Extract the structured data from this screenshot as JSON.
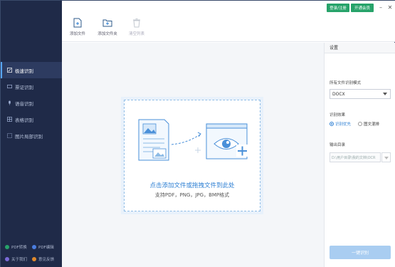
{
  "sidebar": {
    "items": [
      {
        "label": "极速识别",
        "icon": "edit-icon",
        "active": true
      },
      {
        "label": "票证识别",
        "icon": "card-icon",
        "active": false
      },
      {
        "label": "语音识别",
        "icon": "microphone-icon",
        "active": false
      },
      {
        "label": "表格识别",
        "icon": "table-icon",
        "active": false
      },
      {
        "label": "图片局部识别",
        "icon": "crop-icon",
        "active": false
      }
    ],
    "footer": [
      {
        "label": "PDF转换",
        "icon": "pdf-convert-icon",
        "color": "#27a36a"
      },
      {
        "label": "PDF编辑",
        "icon": "pdf-edit-icon",
        "color": "#4a7de0"
      },
      {
        "label": "关于我们",
        "icon": "info-icon",
        "color": "#7a6ad8"
      },
      {
        "label": "意见反馈",
        "icon": "feedback-icon",
        "color": "#e08a2b"
      }
    ]
  },
  "toolbar": {
    "add_file": "添加文件",
    "add_folder": "添加文件夹",
    "clear_list": "清空列表"
  },
  "header": {
    "login_label": "登录/注册",
    "vip_label": "开通会员"
  },
  "dropzone": {
    "title": "点击添加文件或拖拽文件到此处",
    "subtitle": "支持PDF，PNG，JPG，BMP格式"
  },
  "settings": {
    "header": "设置",
    "format_label": "所有文件识别模式",
    "format_value": "DOCX",
    "effect_label": "识别效果",
    "option_speed": "识别优先",
    "option_layout": "图文混排",
    "output_label": "输出目录",
    "output_path": "D:\\用户目录\\我的文档\\OCR",
    "start_label": "一键识别"
  },
  "colors": {
    "sidebar_bg": "#1f2a48",
    "accent": "#2d7fd3",
    "green": "#27a36a"
  }
}
